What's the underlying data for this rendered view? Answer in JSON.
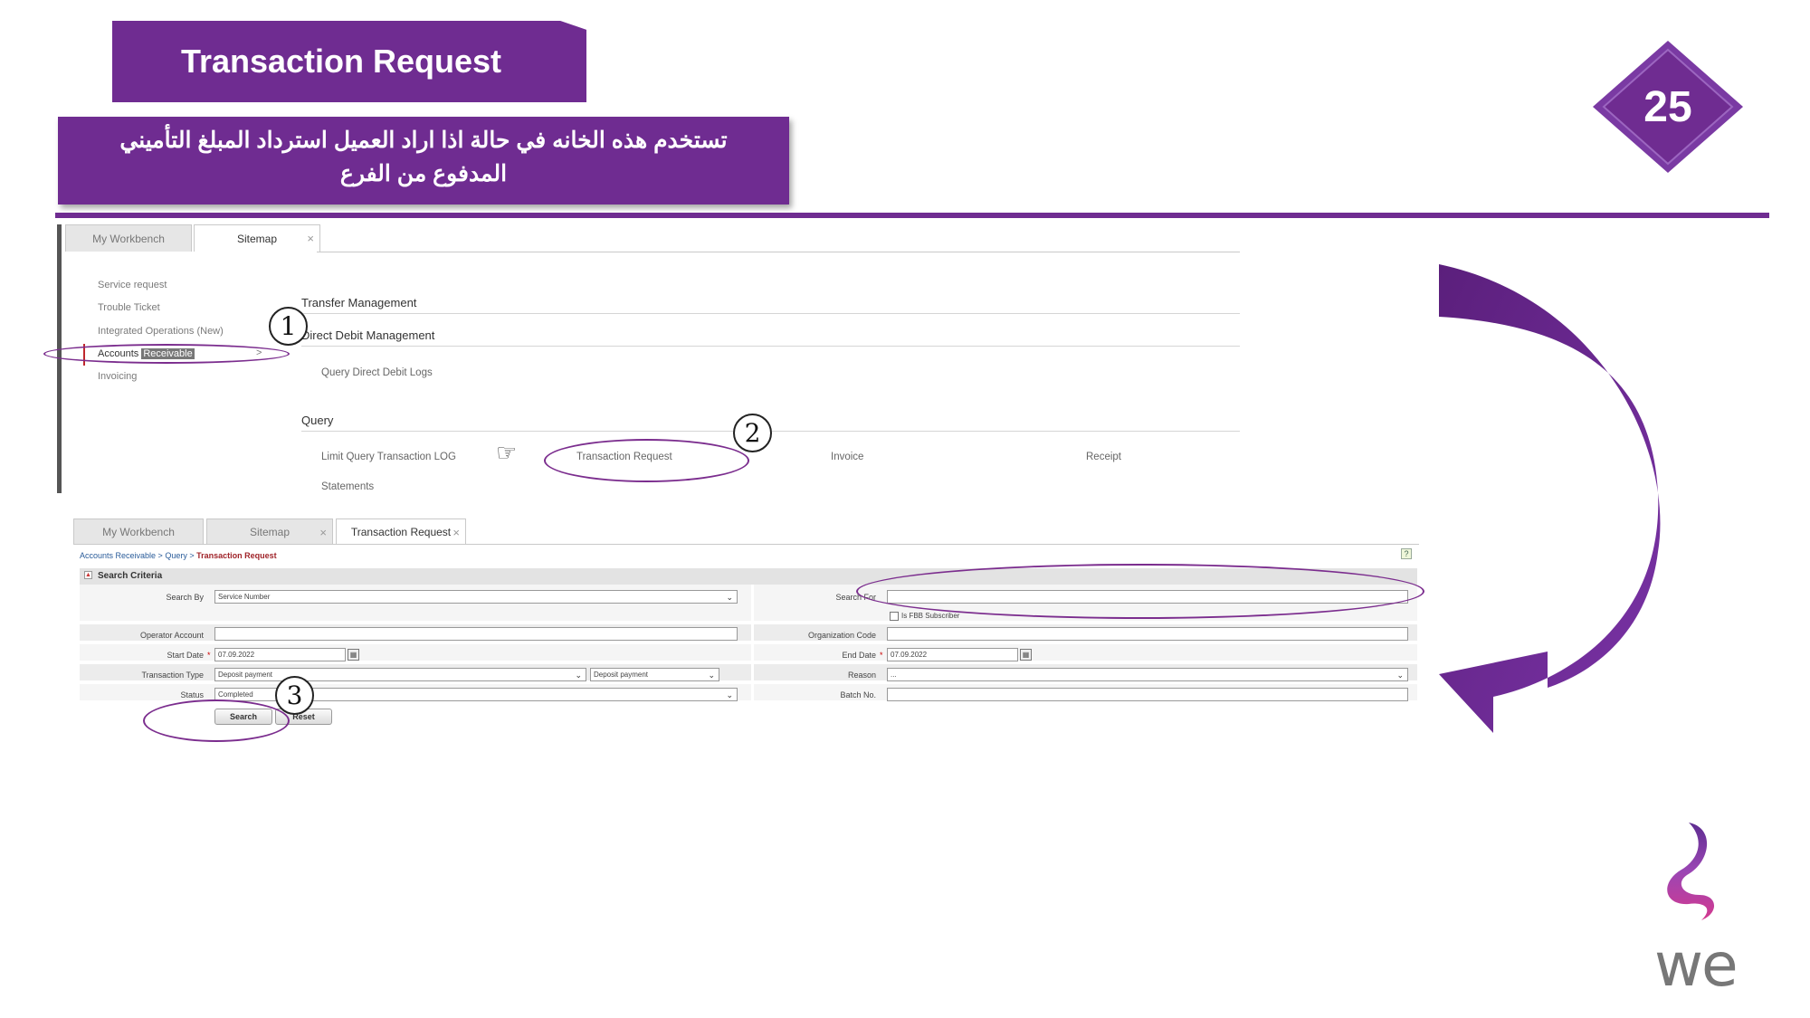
{
  "header": {
    "title": "Transaction Request",
    "arabic_note_line1": "تستخدم هذه الخانه في حالة اذا اراد العميل استرداد المبلغ التأميني",
    "arabic_note_line2": "المدفوع من الفرع",
    "page_number": "25"
  },
  "colors": {
    "brand_purple": "#6f2c91",
    "highlight_oval": "#7b2d8e",
    "breadcrumb_link": "#2a5c9a",
    "breadcrumb_current": "#a0242a"
  },
  "steps": [
    "1",
    "2",
    "3"
  ],
  "screen1": {
    "tabs": [
      {
        "label": "My Workbench"
      },
      {
        "label": "Sitemap",
        "close": "×"
      }
    ],
    "sidebar": [
      {
        "label": "Service request"
      },
      {
        "label": "Trouble Ticket"
      },
      {
        "label": "Integrated Operations (New)"
      },
      {
        "label_a": "Accounts",
        "label_b": "Receivable",
        "chevron": ">"
      },
      {
        "label": "Invoicing"
      }
    ],
    "sections": {
      "transfer": "Transfer Management",
      "direct_debit": "Direct Debit Management",
      "direct_debit_link": "Query Direct Debit Logs",
      "query": "Query",
      "query_links": [
        "Limit Query Transaction LOG",
        "Transaction Request",
        "Invoice",
        "Receipt",
        "Statements"
      ]
    },
    "pointer_icon": "☞"
  },
  "screen2": {
    "tabs": [
      {
        "label": "My Workbench"
      },
      {
        "label": "Sitemap",
        "close": "×"
      },
      {
        "label": "Transaction Request",
        "close": "×"
      }
    ],
    "breadcrumb": {
      "part1": "Accounts Receivable",
      "sep": " > ",
      "part2": "Query",
      "current": "Transaction Request"
    },
    "help_icon": "?",
    "criteria_title": "Search Criteria",
    "fields": {
      "search_by_label": "Search By",
      "search_by_value": "Service Number",
      "search_for_label": "Search For",
      "fbb_label": "Is FBB Subscriber",
      "operator_account_label": "Operator Account",
      "organization_code_label": "Organization Code",
      "start_date_label": "Start Date",
      "start_date_value": "07.09.2022",
      "end_date_label": "End Date",
      "end_date_value": "07.09.2022",
      "transaction_type_label": "Transaction Type",
      "transaction_type_value1": "Deposit payment",
      "transaction_type_value2": "Deposit payment",
      "reason_label": "Reason",
      "reason_value": "...",
      "status_label": "Status",
      "status_value": "Completed",
      "batch_no_label": "Batch No.",
      "required_mark": "*",
      "chevron": "⌄"
    },
    "buttons": {
      "search": "Search",
      "reset": "Reset"
    }
  },
  "logo": {
    "text": "we"
  }
}
